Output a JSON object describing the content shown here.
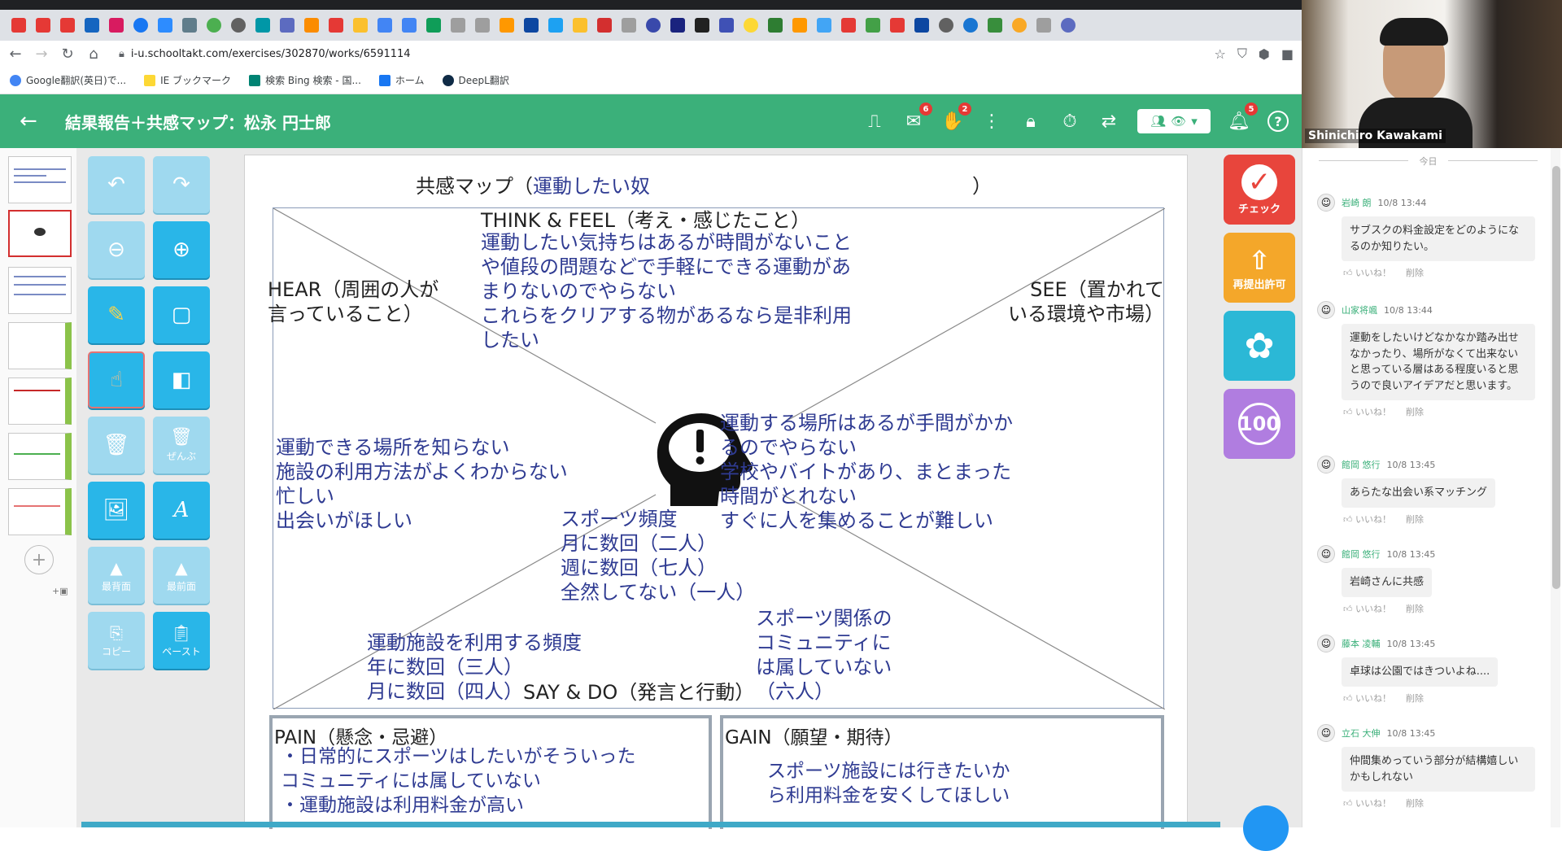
{
  "browser": {
    "url": "i-u.schooltakt.com/exercises/302870/works/6591114",
    "bookmarks": [
      "Google翻訳(英日)で...",
      "IE ブックマーク",
      "検索 Bing 検索 - 国...",
      "ホーム",
      "DeepL翻訳"
    ]
  },
  "header": {
    "title": "結果報告＋共感マップ：松永 円士郎",
    "chat_badge": "6",
    "reaction_badge": "2",
    "notification_badge": "5"
  },
  "tools": {
    "delete_all_label": "ぜんぶ",
    "back_label": "最背面",
    "front_label": "最前面",
    "copy_label": "コピー",
    "paste_label": "ペースト"
  },
  "actions": {
    "check_label": "チェック",
    "resubmit_label": "再提出許可",
    "score_label": "100"
  },
  "map": {
    "heading_prefix": "共感マップ（",
    "heading_target": "運動したい奴",
    "heading_suffix": "）",
    "think_title": "THINK & FEEL（考え・感じたこと）",
    "think_lines": [
      "運動したい気持ちはあるが時間がないこと",
      "や値段の問題などで手軽にできる運動があ",
      "まりないのでやらない",
      "これらをクリアする物があるなら是非利用",
      "したい"
    ],
    "hear_title_1": "HEAR（周囲の人が",
    "hear_title_2": "言っていること）",
    "hear_lines": [
      "運動できる場所を知らない",
      "施設の利用方法がよくわからない",
      "忙しい",
      "出会いがほしい"
    ],
    "see_title_1": "SEE（置かれて",
    "see_title_2": "いる環境や市場）",
    "see_lines": [
      "運動する場所はあるが手間がかか",
      "るのでやらない",
      "学校やバイトがあり、まとまった",
      "時間がとれない",
      "すぐに人を集めることが難しい"
    ],
    "center_lines": [
      "スポーツ頻度",
      "月に数回（二人）",
      "週に数回（七人）",
      "全然してない（一人）"
    ],
    "say_title": "SAY & DO（発言と行動）",
    "say_left_lines": [
      "運動施設を利用する頻度",
      "年に数回（三人）",
      "月に数回（四人）"
    ],
    "say_right_lines": [
      "スポーツ関係の",
      "コミュニティに",
      "は属していない",
      "（六人）"
    ],
    "pain_title": "PAIN（懸念・忌避）",
    "pain_lines": [
      "・日常的にスポーツはしたいがそういった",
      "コミュニティには属していない",
      "・運動施設は利用料金が高い"
    ],
    "gain_title": "GAIN（願望・期待）",
    "gain_lines": [
      "スポーツ施設には行きたいか",
      "ら利用料金を安くしてほしい"
    ]
  },
  "video": {
    "name": "Shinichiro Kawakami"
  },
  "chat": {
    "today": "今日",
    "like_label": "いいね！",
    "delete_label": "削除",
    "messages": [
      {
        "name": "岩崎 朗",
        "time": "10/8 13:44",
        "text": "サブスクの料金設定をどのようになるのか知りたい。"
      },
      {
        "name": "山家将颯",
        "time": "10/8 13:44",
        "text": "運動をしたいけどなかなか踏み出せなかったり、場所がなくて出来ないと思っている層はある程度いると思うので良いアイデアだと思います。"
      },
      {
        "name": "館岡 悠行",
        "time": "10/8 13:45",
        "text": "あらたな出会い系マッチング"
      },
      {
        "name": "館岡 悠行",
        "time": "10/8 13:45",
        "text": "岩崎さんに共感"
      },
      {
        "name": "藤本 凌輔",
        "time": "10/8 13:45",
        "text": "卓球は公園ではきついよね...."
      },
      {
        "name": "立石 大伸",
        "time": "10/8 13:45",
        "text": "仲間集めっていう部分が結構嬉しいかもしれない"
      }
    ]
  },
  "colors": {
    "brand_green": "#3bb07a",
    "tool_blue": "#29b6e8",
    "check_red": "#e8453c",
    "resubmit_orange": "#f4a72a",
    "stamp_teal": "#2bb8d6",
    "score_purple": "#b07de0",
    "ink_blue": "#2f3b92"
  }
}
